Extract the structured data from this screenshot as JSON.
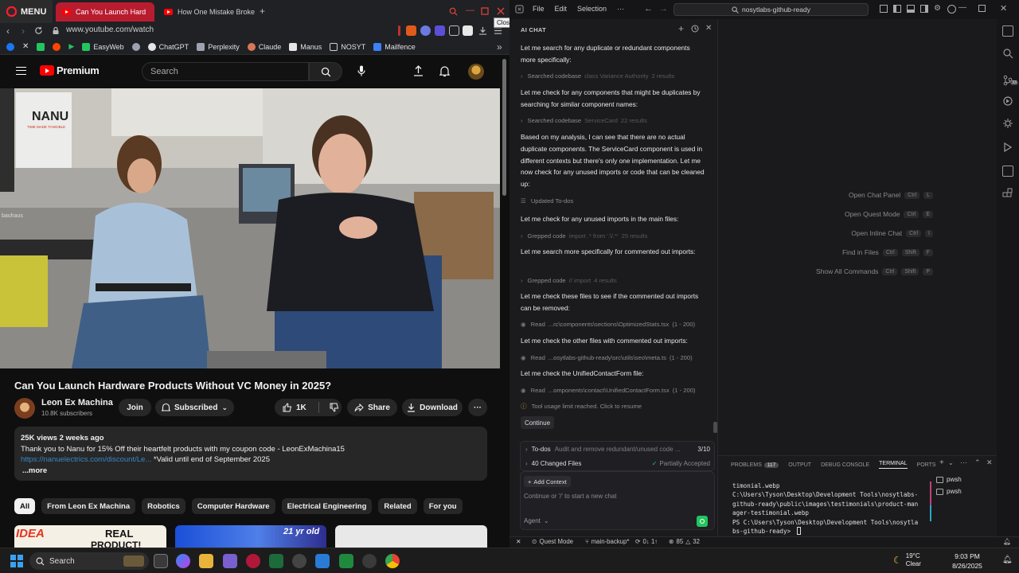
{
  "browser": {
    "menu_label": "MENU",
    "tabs": [
      {
        "title": "Can You Launch Hard",
        "active": true
      },
      {
        "title": "How One Mistake Broke C",
        "active": false
      }
    ],
    "tooltip": "Close",
    "url": "www.youtube.com/watch",
    "bookmarks": [
      {
        "label": "EasyWeb",
        "icon": "easyweb-icon",
        "color": "#22c55e"
      },
      {
        "label": "ChatGPT",
        "icon": "chatgpt-icon",
        "color": "#e5e5e5"
      },
      {
        "label": "Perplexity",
        "icon": "perplexity-icon",
        "color": "#9ca3af"
      },
      {
        "label": "Claude",
        "icon": "claude-icon",
        "color": "#d97757"
      },
      {
        "label": "Manus",
        "icon": "manus-icon",
        "color": "#e5e5e5"
      },
      {
        "label": "NOSYT",
        "icon": "folder-icon",
        "color": "#cfcfcf"
      },
      {
        "label": "Mailfence",
        "icon": "mailfence-icon",
        "color": "#3b82f6"
      }
    ]
  },
  "youtube": {
    "logo_text": "Premium",
    "search_placeholder": "Search",
    "video_title": "Can You Launch Hardware Products Without VC Money in 2025?",
    "video_sign_brand": "NANU",
    "video_sign_tagline": "TIME MADE TANGIBLE",
    "video_sign_small": "bauhaus",
    "channel": {
      "name": "Leon Ex Machina",
      "subscribers": "10.8K subscribers"
    },
    "buttons": {
      "join": "Join",
      "subscribed": "Subscribed",
      "likes": "1K",
      "share": "Share",
      "download": "Download"
    },
    "description": {
      "meta": "25K views  2 weeks ago",
      "line1": "Thank you to Nanu for 15% Off their heartfelt products with my coupon code - LeonExMachina15",
      "link": "https://nanuelectrics.com/discount/Le...",
      "valid": " *Valid until end of September 2025",
      "more": "...more"
    },
    "chips": [
      "All",
      "From Leon Ex Machina",
      "Robotics",
      "Computer Hardware",
      "Electrical Engineering",
      "Related",
      "For you"
    ],
    "thumbnail_texts": {
      "t1a": "IDEA",
      "t1b": "REAL",
      "t1c": "PRODUCT!",
      "t2": "21 yr old"
    }
  },
  "ide": {
    "menus": [
      "File",
      "Edit",
      "Selection",
      "···"
    ],
    "search": "nosytlabs-github-ready",
    "chat_title": "AI CHAT",
    "messages": [
      {
        "type": "text",
        "text": "Let me search for any duplicate or redundant components more specifically:"
      },
      {
        "type": "tool",
        "action": "Searched codebase",
        "detail": "class Variance Authority",
        "result": "2 results"
      },
      {
        "type": "text",
        "text": "Let me check for any components that might be duplicates by searching for similar component names:"
      },
      {
        "type": "tool",
        "action": "Searched codebase",
        "detail": "ServiceCard",
        "result": "22 results"
      },
      {
        "type": "text",
        "text": "Based on my analysis, I can see that there are no actual duplicate components. The ServiceCard component is used in different contexts but there's only one implementation. Let me now check for any unused imports or code that can be cleaned up:"
      },
      {
        "type": "tool",
        "action": "Updated To-dos",
        "detail": "",
        "result": ""
      },
      {
        "type": "text",
        "text": "Let me check for any unused imports in the main files:"
      },
      {
        "type": "tool",
        "action": "Grepped code",
        "detail": "import .* from '.\\/.*'",
        "result": "25 results"
      },
      {
        "type": "text",
        "text": "Let me search more specifically for commented out imports:"
      },
      {
        "type": "tool",
        "action": "Grepped code",
        "detail": "// import",
        "result": "4 results"
      },
      {
        "type": "text",
        "text": "Let me check these files to see if the commented out imports can be removed:"
      },
      {
        "type": "tool",
        "action": "Read",
        "detail": "...rc\\components\\sections\\OptimizedStats.tsx",
        "result": "(1 - 200)"
      },
      {
        "type": "text",
        "text": "Let me check the other files with commented out imports:"
      },
      {
        "type": "tool",
        "action": "Read",
        "detail": "...osytlabs-github-ready\\src\\utils\\seo\\meta.ts",
        "result": "(1 - 200)"
      },
      {
        "type": "text",
        "text": "Let me check the UnifiedContactForm file:"
      },
      {
        "type": "tool",
        "action": "Read",
        "detail": "...omponents\\contact\\UnifiedContactForm.tsx",
        "result": "(1 - 200)"
      },
      {
        "type": "tool",
        "action": "Tool usage limit reached. Click to resume",
        "detail": "",
        "result": ""
      }
    ],
    "continue_label": "Continue",
    "todos": {
      "label": "To-dos",
      "detail": "Audit and remove redundant/unused code ...",
      "count": "3/10"
    },
    "changes": {
      "label": "40 Changed Files",
      "status": "Partially Accepted"
    },
    "add_context": "Add Context",
    "composer_placeholder": "Continue or '/' to start a new chat",
    "agent_label": "Agent",
    "welcome_shortcuts": [
      {
        "label": "Open Chat Panel",
        "keys": [
          "Ctrl",
          "L"
        ]
      },
      {
        "label": "Open Quest Mode",
        "keys": [
          "Ctrl",
          "E"
        ]
      },
      {
        "label": "Open Inline Chat",
        "keys": [
          "Ctrl",
          "I"
        ]
      },
      {
        "label": "Find in Files",
        "keys": [
          "Ctrl",
          "Shift",
          "F"
        ]
      },
      {
        "label": "Show All Commands",
        "keys": [
          "Ctrl",
          "Shift",
          "P"
        ]
      }
    ],
    "panel_tabs": {
      "problems": "PROBLEMS",
      "problems_count": "117",
      "output": "OUTPUT",
      "debug": "DEBUG CONSOLE",
      "terminal": "TERMINAL",
      "ports": "PORTS"
    },
    "terminal_text": "timonial.webp\nC:\\Users\\Tyson\\Desktop\\Development Tools\\nosytlabs-\ngithub-ready\\public\\images\\testimonials\\product-man\nager-testimonial.webp\nPS C:\\Users\\Tyson\\Desktop\\Development Tools\\nosytla\nbs-github-ready> ",
    "terminals": [
      "pwsh",
      "pwsh"
    ],
    "status": {
      "quest": "Quest Mode",
      "branch": "main-backup*",
      "sync": "0↓ 1↑",
      "errors": "85",
      "warnings": "32"
    }
  },
  "taskbar": {
    "search_placeholder": "Search",
    "weather_temp": "19°C",
    "weather_desc": "Clear",
    "time": "9:03 PM",
    "date": "8/26/2025"
  }
}
